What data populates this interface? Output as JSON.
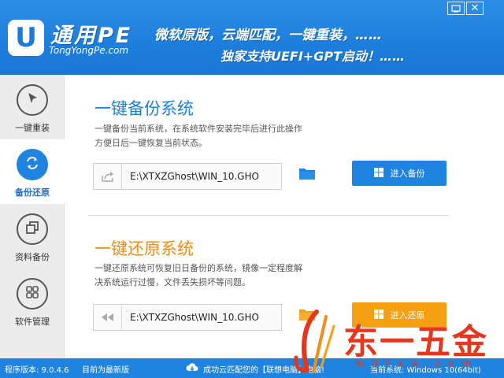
{
  "header": {
    "logo_letter": "U",
    "logo_name": "通用PE",
    "logo_site": "TongYongPe.com",
    "slogan_line1": "微软原版，云端匹配，一键重装，……",
    "slogan_line2": "独家支持UEFI+GPT启动！……",
    "close_glyph": "✕"
  },
  "sidebar": {
    "items": [
      {
        "label": "一键重装",
        "icon": "cursor-arrow-icon",
        "active": false
      },
      {
        "label": "备份还原",
        "icon": "sync-arrows-icon",
        "active": true
      },
      {
        "label": "资料备份",
        "icon": "copy-squares-icon",
        "active": false
      },
      {
        "label": "软件管理",
        "icon": "grid-apps-icon",
        "active": false
      }
    ]
  },
  "backup": {
    "title": "一键备份系统",
    "desc_line1": "一键备份当前系统，在系统软件安装完毕后进行此操作",
    "desc_line2": "方便日后一键恢复当前状态。",
    "path": "E:\\XTXZGhost\\WIN_10.GHO",
    "button_label": "进入备份"
  },
  "restore": {
    "title": "一键还原系统",
    "desc_line1": "一键还原系统可恢复旧日备份的系统，镜像一定程度解",
    "desc_line2": "决系统运行过慢，文件丢失损坏等问题。",
    "path": "E:\\XTXZGhost\\WIN_10.GHO",
    "button_label": "进入还原"
  },
  "status": {
    "version": "程序版本: 9.0.4.6",
    "update": "目前为最新版",
    "cloud": "成功云匹配您的【联想电脑】电脑!",
    "system": "当前系统: Windows 10(64bit)"
  },
  "watermark": {
    "text": "东一五金",
    "sub": "mdzxw.com"
  },
  "colors": {
    "accent_blue": "#1e84e0",
    "accent_orange": "#f5a013",
    "title_orange": "#f08c17",
    "watermark_red": "#e5371e"
  }
}
